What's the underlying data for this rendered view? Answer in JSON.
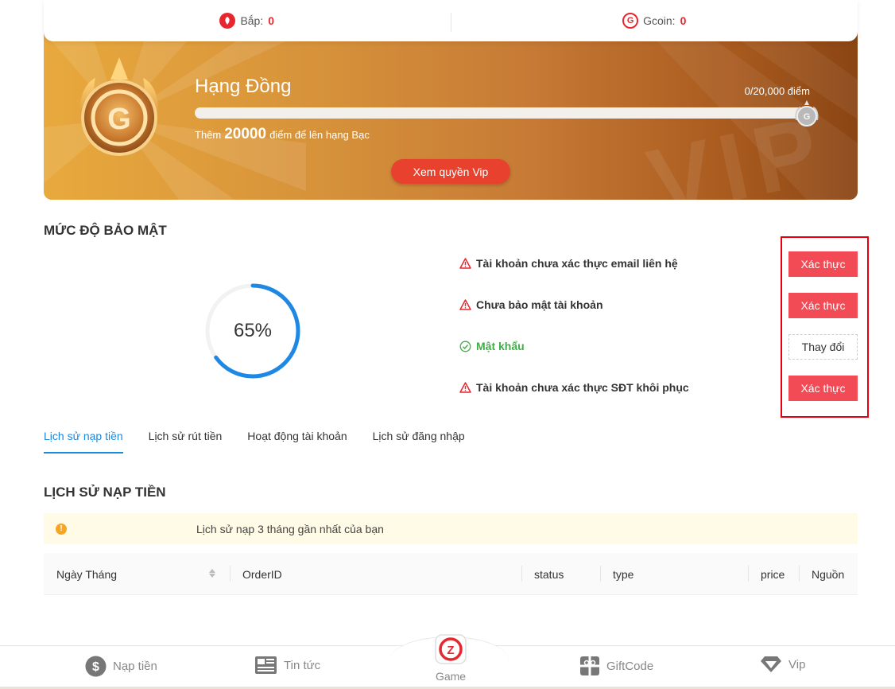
{
  "currency": {
    "bap_label": "Bắp:",
    "bap_value": "0",
    "gcoin_label": "Gcoin:",
    "gcoin_value": "0"
  },
  "vip": {
    "rank_title": "Hạng Đồng",
    "points": "0/20,000 điểm",
    "progress_fraction": 0,
    "hint_prefix": "Thêm",
    "hint_points": "20000",
    "hint_suffix": "điểm để lên hạng Bạc",
    "button_label": "Xem quyền Vip",
    "watermark": "VIP"
  },
  "security": {
    "title": "MỨC ĐỘ BẢO MẬT",
    "percent_text": "65%",
    "percent_value": 65,
    "items": [
      {
        "label": "Tài khoản chưa xác thực email liên hệ",
        "status": "warning",
        "action": "Xác thực"
      },
      {
        "label": "Chưa bảo mật tài khoản",
        "status": "warning",
        "action": "Xác thực"
      },
      {
        "label": "Mật khẩu",
        "status": "ok",
        "action": "Thay đổi"
      },
      {
        "label": "Tài khoản chưa xác thực SĐT khôi phục",
        "status": "warning",
        "action": "Xác thực"
      }
    ]
  },
  "tabs": [
    {
      "label": "Lịch sử nạp tiền",
      "active": true
    },
    {
      "label": "Lịch sử rút tiền",
      "active": false
    },
    {
      "label": "Hoạt động tài khoản",
      "active": false
    },
    {
      "label": "Lịch sử đăng nhập",
      "active": false
    }
  ],
  "history": {
    "title": "LỊCH SỬ NẠP TIỀN",
    "notice": "Lịch sử nạp 3 tháng gần nhất của bạn",
    "columns": [
      "Ngày Tháng",
      "OrderID",
      "status",
      "type",
      "price",
      "Nguồn"
    ]
  },
  "bottom_nav": {
    "deposit": "Nạp tiền",
    "news": "Tin tức",
    "game": "Game",
    "giftcode": "GiftCode",
    "vip": "Vip"
  },
  "colors": {
    "accent_red": "#e8262d",
    "button_red": "#f24b55",
    "gauge_blue": "#1e88e5",
    "ok_green": "#3fae49",
    "tab_blue": "#1e88d9"
  }
}
